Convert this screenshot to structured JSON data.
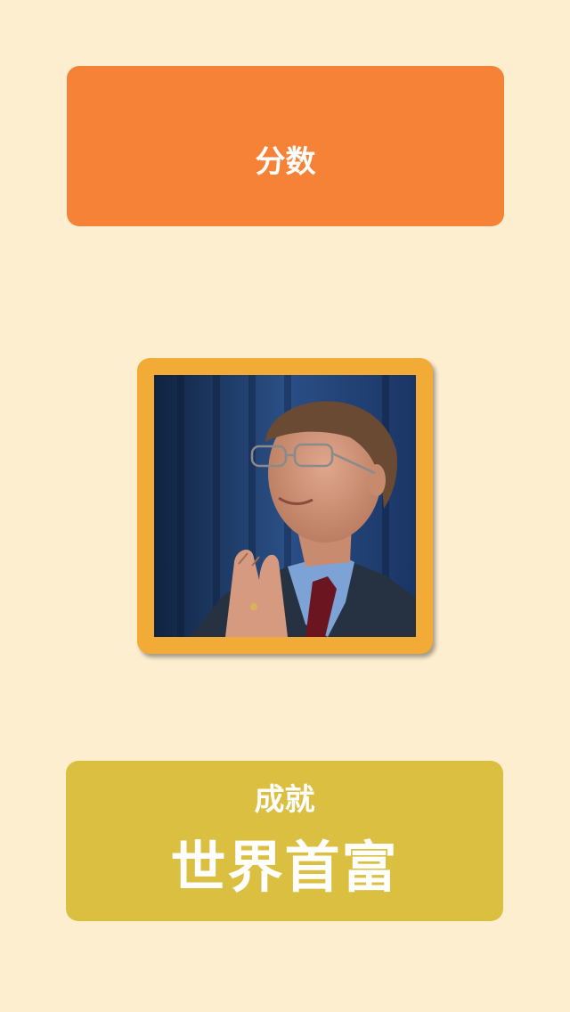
{
  "score": {
    "title": "分数",
    "value": ""
  },
  "portrait": {
    "icon": "person-photo",
    "frame_color": "#f2ab36"
  },
  "achievement": {
    "label": "成就",
    "value": "世界首富"
  },
  "colors": {
    "background": "#fdeed0",
    "score_card": "#f58236",
    "achievement_card": "#dbbf40",
    "text": "#ffffff"
  }
}
